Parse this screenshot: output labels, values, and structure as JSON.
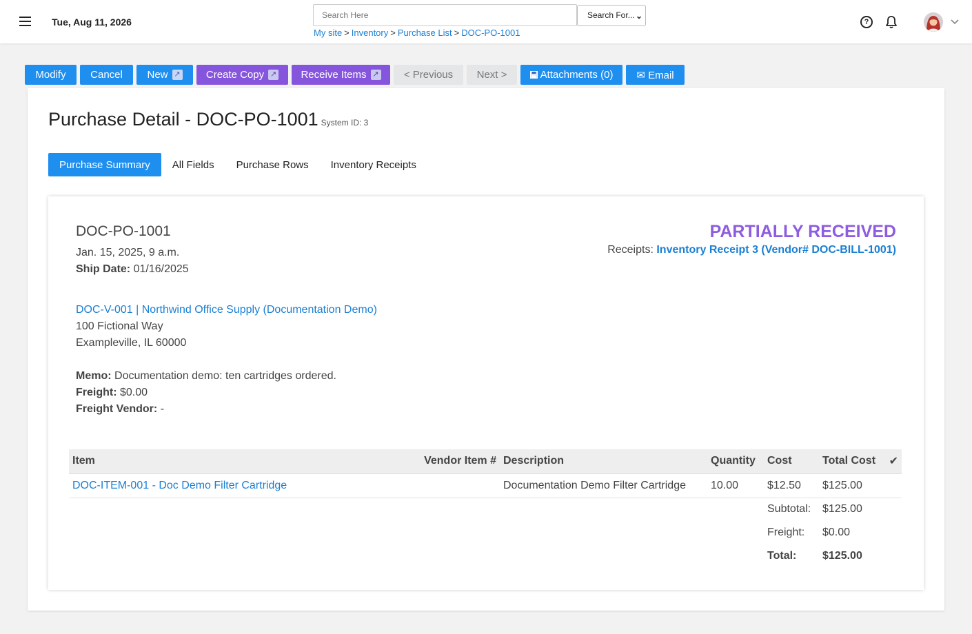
{
  "header": {
    "date": "Tue, Aug 11, 2026",
    "search_placeholder": "Search Here",
    "search_select": "Search For...",
    "breadcrumb": [
      "My site",
      "Inventory",
      "Purchase List",
      "DOC-PO-1001"
    ],
    "breadcrumb_separator": ">"
  },
  "toolbar": {
    "modify": "Modify",
    "cancel": "Cancel",
    "new": "New",
    "create_copy": "Create Copy",
    "receive_items": "Receive Items",
    "previous": "< Previous",
    "next": "Next >",
    "attachments": "Attachments (0)",
    "email": "✉ Email",
    "external_glyph": "↗"
  },
  "page": {
    "title": "Purchase Detail - DOC-PO-1001",
    "system_id": "System ID: 3",
    "tabs": [
      "Purchase Summary",
      "All Fields",
      "Purchase Rows",
      "Inventory Receipts"
    ],
    "active_tab": 0
  },
  "summary": {
    "po_number": "DOC-PO-1001",
    "date": "Jan. 15, 2025, 9 a.m.",
    "ship_date_label": "Ship Date:",
    "ship_date": "01/16/2025",
    "status": "PARTIALLY RECEIVED",
    "receipts_label": "Receipts:",
    "receipts_link": "Inventory Receipt 3 (Vendor# DOC-BILL-1001)",
    "vendor_link": "DOC-V-001 | Northwind Office Supply (Documentation Demo)",
    "address_line1": "100 Fictional Way",
    "address_line2": "Exampleville, IL 60000",
    "memo_label": "Memo:",
    "memo": "Documentation demo: ten cartridges ordered.",
    "freight_label": "Freight:",
    "freight": "$0.00",
    "freight_vendor_label": "Freight Vendor:",
    "freight_vendor": "-"
  },
  "table": {
    "headers": [
      "Item",
      "Vendor Item #",
      "Description",
      "Quantity",
      "Cost",
      "Total Cost",
      "✔"
    ],
    "rows": [
      {
        "item": "DOC-ITEM-001 - Doc Demo Filter Cartridge",
        "vendor_item": "",
        "description": "Documentation Demo Filter Cartridge",
        "quantity": "10.00",
        "cost": "$12.50",
        "total_cost": "$125.00"
      }
    ],
    "subtotal_label": "Subtotal:",
    "subtotal": "$125.00",
    "freight_label": "Freight:",
    "freight": "$0.00",
    "total_label": "Total:",
    "total": "$125.00"
  },
  "colors": {
    "primary_blue": "#1e8eef",
    "purple": "#8655de",
    "status_purple": "#8d5ce0",
    "link": "#1a7fd4"
  },
  "icons": {
    "menu": "hamburger-icon",
    "help": "help-circle-icon",
    "bell": "bell-icon",
    "attachments": "floppy-disk-icon",
    "external": "external-link-icon"
  }
}
